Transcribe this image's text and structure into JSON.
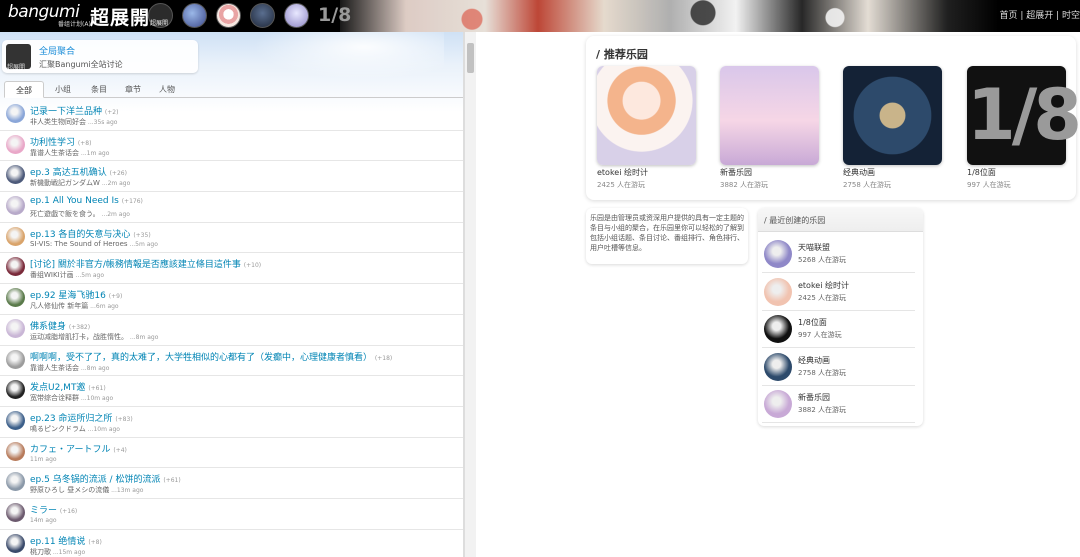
{
  "header": {
    "logo": "bangumi",
    "logo_sub": "番组计划(A)",
    "site_title": "超展開",
    "avatar_label": "超展開",
    "avatar_last": "1/8",
    "nav": "首页 | 超展开 | 时空"
  },
  "hero": {
    "thumb_label": "超展開",
    "title": "全局聚合",
    "desc": "汇聚Bangumi全站讨论"
  },
  "tabs": [
    "全部",
    "小组",
    "条目",
    "章节",
    "人物"
  ],
  "feed": [
    {
      "title": "记录一下洋兰品种",
      "count": "(+2)",
      "sub": "非人类生物同好会",
      "time": "35s ago",
      "color": "#8aa6d8"
    },
    {
      "title": "功利性学习",
      "count": "(+8)",
      "sub": "靠谱人生茶话会",
      "time": "1m ago",
      "color": "#e9a7c8"
    },
    {
      "title": "ep.3 高达五机确认",
      "count": "(+26)",
      "sub": "新機動戦記ガンダムW",
      "time": "2m ago",
      "color": "#4d5a7a"
    },
    {
      "title": "ep.1 All You Need Is",
      "count": "(+176)",
      "sub": "死亡遊戯で飯を食う。",
      "time": "2m ago",
      "color": "#b7a9c9"
    },
    {
      "title": "ep.13 各自的矢意与决心",
      "count": "(+35)",
      "sub": "SI-VIS: The Sound of Heroes",
      "time": "5m ago",
      "color": "#d9a36a"
    },
    {
      "title": "[讨论] 關於非官方/帳務情報是否應該建立條目這件事",
      "count": "(+10)",
      "sub": "番组WIKI计画",
      "time": "5m ago",
      "color": "#7a2a3a"
    },
    {
      "title": "ep.92 星海飞驰16",
      "count": "(+9)",
      "sub": "凡人修仙传 新年篇",
      "time": "6m ago",
      "color": "#5a7a4a"
    },
    {
      "title": "佛系健身",
      "count": "(+382)",
      "sub": "运动减脂增肌打卡，战胜惰性。",
      "time": "8m ago",
      "color": "#c9b6d6"
    },
    {
      "title": "啊啊啊，受不了了，真的太难了，大学牲相似的心都有了（发癫中，心理健康者慎看）",
      "count": "(+18)",
      "sub": "靠谱人生茶话会",
      "time": "8m ago",
      "color": "#9c9c9c"
    },
    {
      "title": "发点U2,MT邀",
      "count": "(+61)",
      "sub": "宽带综合诠释群",
      "time": "10m ago",
      "color": "#222222"
    },
    {
      "title": "ep.23 命运所归之所",
      "count": "(+83)",
      "sub": "鳴るピンクドラム",
      "time": "10m ago",
      "color": "#3c5f8a"
    },
    {
      "title": "カフェ・アートフル",
      "count": "(+4)",
      "sub": "",
      "time": "11m ago",
      "color": "#b77a5a"
    },
    {
      "title": "ep.5 乌冬锅的流派 / 松饼的流派",
      "count": "(+61)",
      "sub": "野原ひろし 昼メシの流儀",
      "time": "13m ago",
      "color": "#8a98a8"
    },
    {
      "title": "ミラー",
      "count": "(+16)",
      "sub": "",
      "time": "14m ago",
      "color": "#6c5a6e"
    },
    {
      "title": "ep.11 绝情说",
      "count": "(+8)",
      "sub": "桃刀歌",
      "time": "15m ago",
      "color": "#3a4a6a"
    }
  ],
  "recommend": {
    "title": "/ 推荐乐园",
    "items": [
      {
        "name": "etokei 绘时计",
        "stat": "2425 人在游玩"
      },
      {
        "name": "新番乐园",
        "stat": "3882 人在游玩"
      },
      {
        "name": "经典动画",
        "stat": "2758 人在游玩"
      },
      {
        "name": "1/8位面",
        "stat": "997 人在游玩",
        "cover_text": "1/8"
      }
    ]
  },
  "info": "乐园是由管理员或资深用户提供的具有一定主题的条目与小组的聚合，在乐园里你可以轻松的了解到包括小组话题、条目讨论、番组排行、角色排行、用户吐槽等信息。",
  "recent": {
    "title": "/ 最近创建的乐园",
    "items": [
      {
        "name": "天喵联盟",
        "stat": "5268 人在游玩",
        "color": "#8f88c8"
      },
      {
        "name": "etokei 绘时计",
        "stat": "2425 人在游玩",
        "color": "#f1c3b0"
      },
      {
        "name": "1/8位面",
        "stat": "997 人在游玩",
        "color": "#111111"
      },
      {
        "name": "经典动画",
        "stat": "2758 人在游玩",
        "color": "#2d4a6b"
      },
      {
        "name": "新番乐园",
        "stat": "3882 人在游玩",
        "color": "#c8a9d6"
      }
    ]
  }
}
